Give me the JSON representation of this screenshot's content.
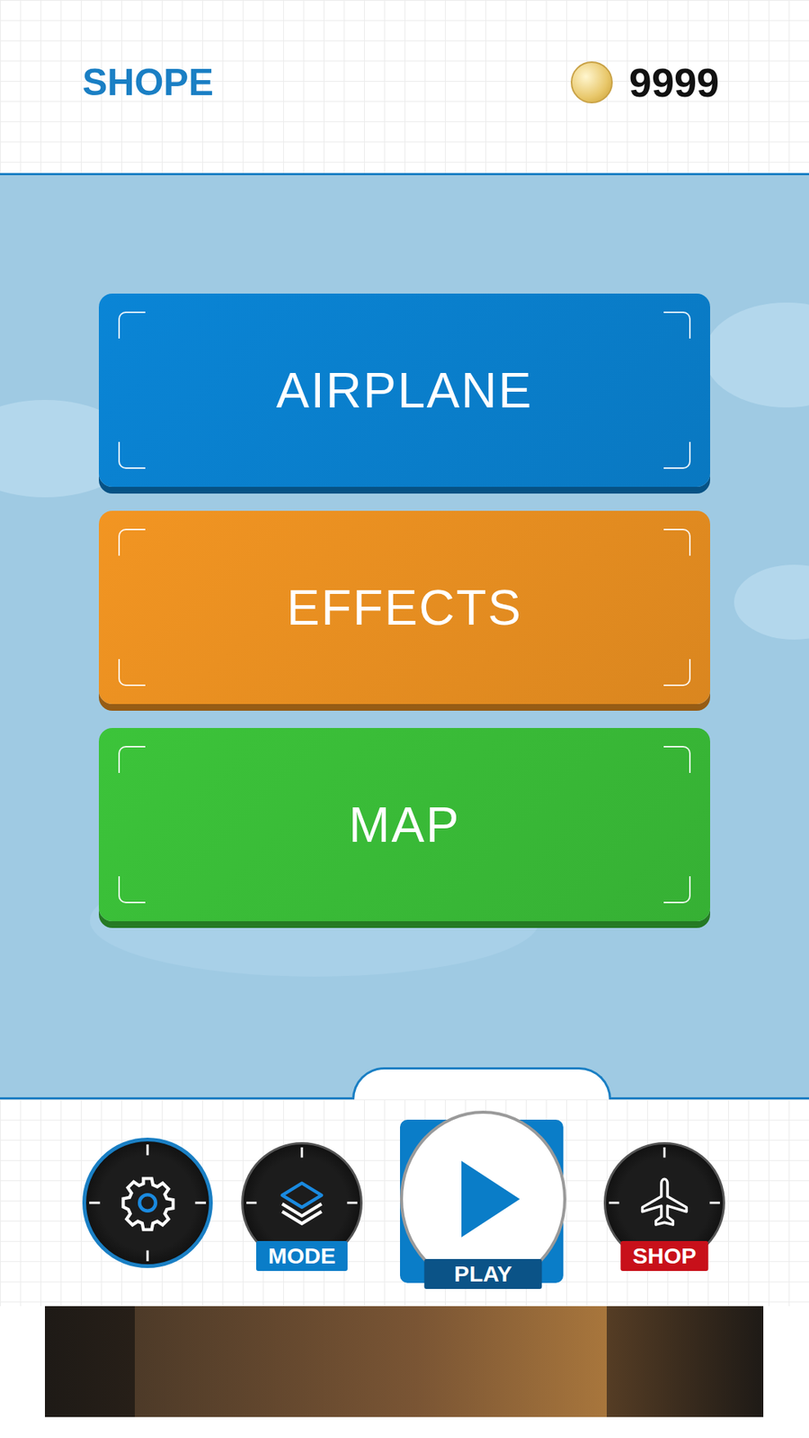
{
  "header": {
    "title": "SHOPE",
    "coins": "9999"
  },
  "categories": [
    {
      "label": "AIRPLANE",
      "color": "#0a85d6"
    },
    {
      "label": "EFFECTS",
      "color": "#f29522"
    },
    {
      "label": "MAP",
      "color": "#3cc43a"
    }
  ],
  "nav": [
    {
      "kind": "settings",
      "selected": true
    },
    {
      "kind": "mode",
      "label": "MODE",
      "selected": false,
      "color": "#0a7dc8"
    },
    {
      "kind": "play",
      "label": "PLAY",
      "selected": false,
      "color": "#0b5387"
    },
    {
      "kind": "shop",
      "label": "SHOP",
      "selected": false,
      "color": "#c8101a"
    }
  ],
  "ad": {
    "kind": "banner"
  }
}
